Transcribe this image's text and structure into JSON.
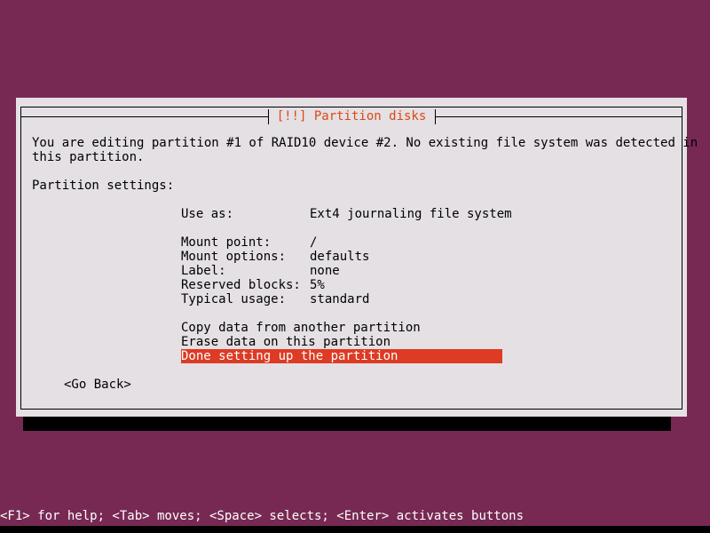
{
  "screen": {
    "background_color": "#772953",
    "accent_color": "#dd4814",
    "highlight_color": "#dd3b24",
    "panel_color": "#e4e0e4"
  },
  "dialog": {
    "title": "[!!] Partition disks",
    "intro": {
      "line1": "You are editing partition #1 of RAID10 device #2. No existing file system was detected in",
      "line2": "this partition."
    },
    "settings_heading": "Partition settings:",
    "use_as": {
      "label": "Use as:",
      "value": "Ext4 journaling file system"
    },
    "settings": [
      {
        "label": "Mount point:",
        "value": "/"
      },
      {
        "label": "Mount options:",
        "value": "defaults"
      },
      {
        "label": "Label:",
        "value": "none"
      },
      {
        "label": "Reserved blocks:",
        "value": "5%"
      },
      {
        "label": "Typical usage:",
        "value": "standard"
      }
    ],
    "actions": [
      {
        "label": "Copy data from another partition",
        "selected": false
      },
      {
        "label": "Erase data on this partition",
        "selected": false
      },
      {
        "label": "Done setting up the partition",
        "selected": true
      }
    ],
    "go_back": "<Go Back>"
  },
  "footer": {
    "help_text": "<F1> for help; <Tab> moves; <Space> selects; <Enter> activates buttons"
  }
}
